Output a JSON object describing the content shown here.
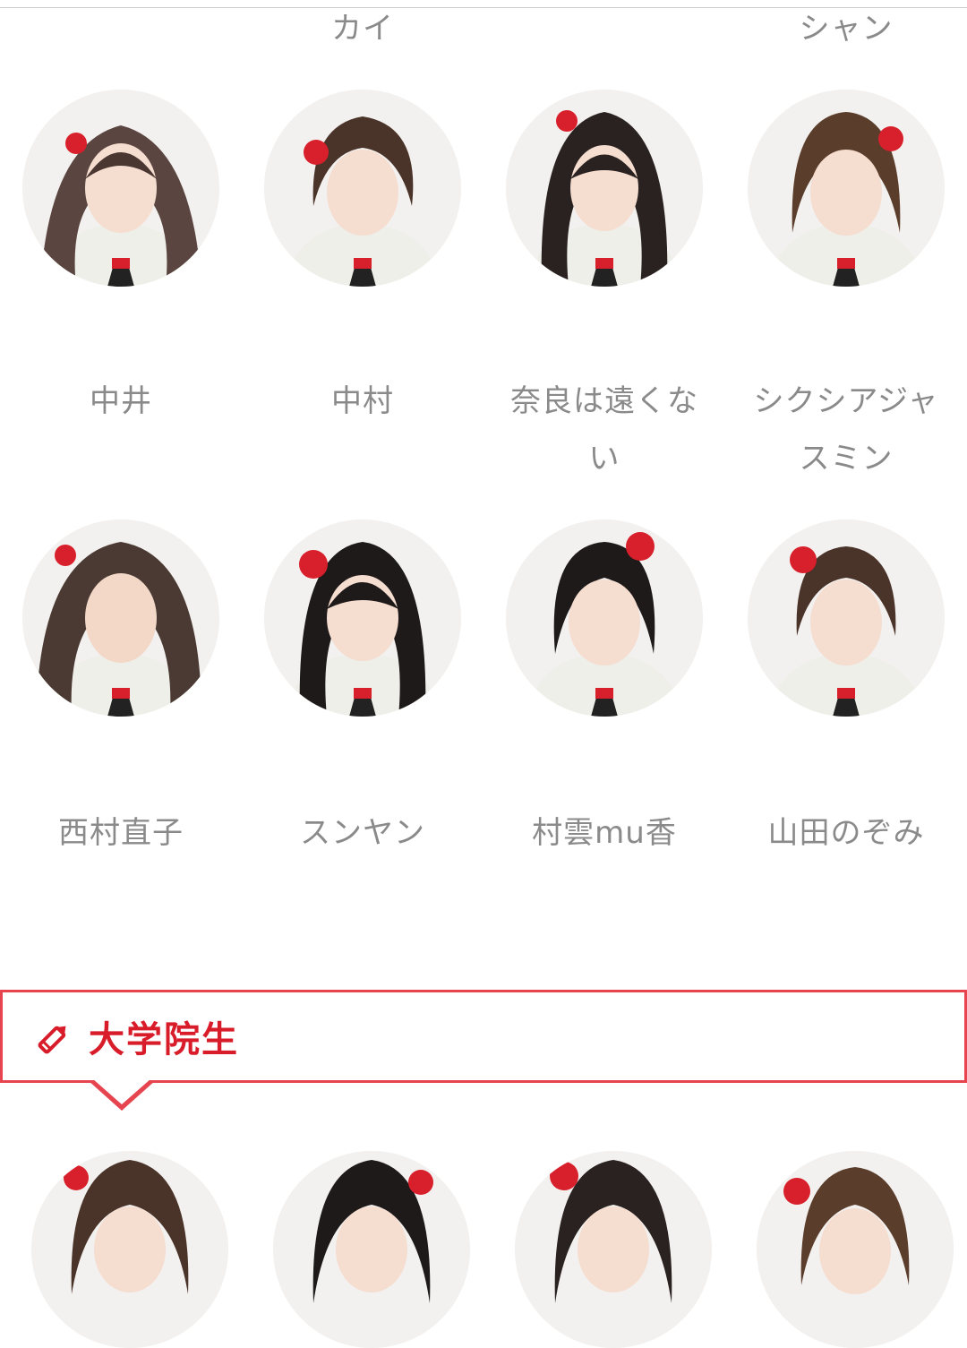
{
  "partial_names_top": [
    "カイ",
    "シャン"
  ],
  "row1": [
    {
      "name": "中井",
      "tail": ""
    },
    {
      "name": "中村",
      "tail": ""
    },
    {
      "name": "奈良は遠くな",
      "tail": "い"
    },
    {
      "name": "シクシアジャ",
      "tail": "スミン"
    }
  ],
  "row2": [
    {
      "name": "西村直子"
    },
    {
      "name": "スンヤン"
    },
    {
      "name": "村雲mu香"
    },
    {
      "name": "山田のぞみ"
    }
  ],
  "section": {
    "title": "大学院生",
    "icon": "pencil-icon"
  },
  "colors": {
    "accent": "#e6454f",
    "title": "#d81c2a",
    "name_text": "#8a8a8a"
  }
}
